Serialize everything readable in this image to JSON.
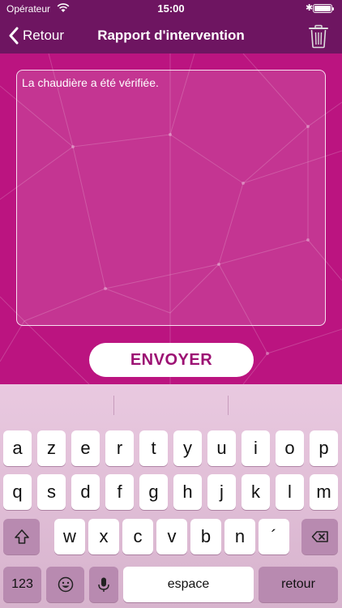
{
  "status_bar": {
    "carrier": "Opérateur",
    "time": "15:00",
    "bluetooth": "✱",
    "battery_level": 1.0
  },
  "nav": {
    "back_label": "Retour",
    "title": "Rapport d'intervention",
    "trash_icon": "trash-icon"
  },
  "report": {
    "value": "La chaudière a été vérifiée."
  },
  "send_button": {
    "label": "ENVOYER"
  },
  "keyboard": {
    "row1": [
      "a",
      "z",
      "e",
      "r",
      "t",
      "y",
      "u",
      "i",
      "o",
      "p"
    ],
    "row2": [
      "q",
      "s",
      "d",
      "f",
      "g",
      "h",
      "j",
      "k",
      "l",
      "m"
    ],
    "row3": [
      "w",
      "x",
      "c",
      "v",
      "b",
      "n",
      "´"
    ],
    "numbers_label": "123",
    "space_label": "espace",
    "return_label": "retour"
  },
  "colors": {
    "nav_bg": "#6e1561",
    "content_bg": "#bb1480",
    "button_text": "#9c1173"
  }
}
